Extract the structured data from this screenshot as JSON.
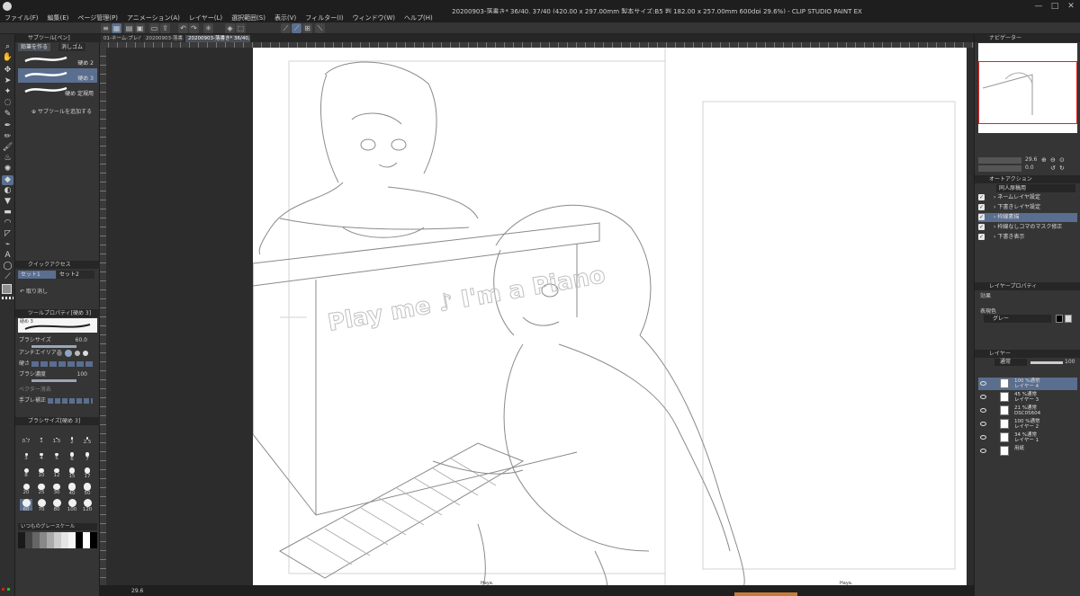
{
  "window": {
    "title": "20200903-落書き* 36/40, 37/40 (420.00 x 297.00mm 製本サイズ:B5 判 182.00 x 257.00mm 600dpi 29.6%) - CLIP STUDIO PAINT EX"
  },
  "menu": [
    "ファイル(F)",
    "編集(E)",
    "ページ管理(P)",
    "アニメーション(A)",
    "レイヤー(L)",
    "選択範囲(S)",
    "表示(V)",
    "フィルター(I)",
    "ウィンドウ(W)",
    "ヘルプ(H)"
  ],
  "doc_tabs": [
    "01-ネーム-プレハ...",
    "20200903-落書...",
    "20200903-落書き* 36/40, 37/40"
  ],
  "subtool": {
    "panel_title": "サブツール[ペン]",
    "tabs": [
      "鉛筆を作る",
      "消しゴム"
    ],
    "brushes": [
      {
        "name": "硬め 2"
      },
      {
        "name": "硬め 3"
      },
      {
        "name": "硬め 定規用"
      }
    ],
    "add_label": "サブツールを追加する"
  },
  "quick_access": {
    "title": "クイックアクセス",
    "sets": [
      "セット1",
      "セット2"
    ],
    "item": "取り消し"
  },
  "tool_property": {
    "title": "ツールプロパティ[硬め 3]",
    "preview_label": "硬め 3",
    "rows": [
      {
        "label": "ブラシサイズ",
        "value": "60.0"
      },
      {
        "label": "アンチエイリアス",
        "value": ""
      },
      {
        "label": "硬さ",
        "value": ""
      },
      {
        "label": "ブラシ濃度",
        "value": "100"
      },
      {
        "label": "ベクター消去",
        "value": ""
      },
      {
        "label": "手ブレ補正",
        "value": ""
      }
    ]
  },
  "brush_size": {
    "title": "ブラシサイズ[硬め 3]",
    "sizes": [
      "0.7",
      "1",
      "1.5",
      "2",
      "2.5",
      "3",
      "4",
      "5",
      "6",
      "7",
      "8",
      "10",
      "12",
      "15",
      "17",
      "20",
      "25",
      "30",
      "40",
      "50",
      "60",
      "70",
      "80",
      "100",
      "120"
    ],
    "selected": "60"
  },
  "color_set": {
    "title": "いつものグレースケール"
  },
  "navigator": {
    "title": "ナビゲーター",
    "zoom": "29.6",
    "rotation": "0.0"
  },
  "auto_action": {
    "title": "オートアクション",
    "set_name": "同人原稿用",
    "items": [
      "ネームレイヤ設定",
      "下書きレイヤ設定",
      "枠線素描",
      "枠線なしコマのマスク修正",
      "下書き表示"
    ],
    "selected_index": 2
  },
  "layer_property": {
    "title": "レイヤープロパティ",
    "effect_label": "効果",
    "expression_label": "表現色",
    "expression_value": "グレー"
  },
  "layers": {
    "title": "レイヤー",
    "blend_mode": "通常",
    "opacity": "100",
    "items": [
      {
        "pct": "100 %通常",
        "name": "レイヤー 4"
      },
      {
        "pct": "45 %通常",
        "name": "レイヤー 3"
      },
      {
        "pct": "21 %通常",
        "name": "DSC05604"
      },
      {
        "pct": "100 %通常",
        "name": "レイヤー 2"
      },
      {
        "pct": "34 %通常",
        "name": "レイヤー 1"
      },
      {
        "pct": "",
        "name": "用紙"
      }
    ],
    "selected_index": 0
  },
  "canvas": {
    "piano_text": "Play me ♪ I'm a Piano",
    "page_labels": [
      "Haya.",
      "Haya."
    ]
  },
  "status": {
    "zoom": "29.6"
  },
  "colors": {
    "accent": "#5a6e8f",
    "panel_bg": "#353535",
    "header_bg": "#262626",
    "paper": "#ffffff"
  }
}
